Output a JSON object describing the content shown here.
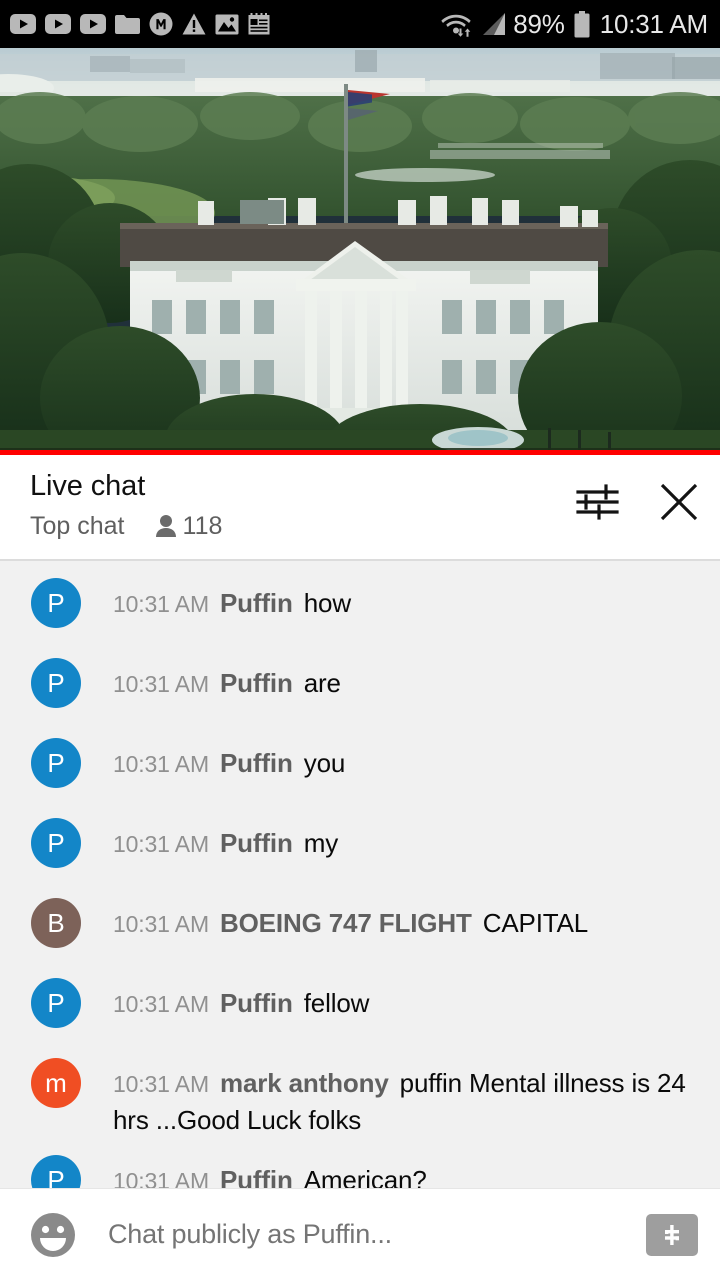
{
  "status_bar": {
    "left_icons": [
      {
        "name": "youtube-notification-icon-1",
        "glyph": "youtube"
      },
      {
        "name": "youtube-notification-icon-2",
        "glyph": "youtube"
      },
      {
        "name": "youtube-notification-icon-3",
        "glyph": "youtube"
      },
      {
        "name": "folder-icon",
        "glyph": "folder"
      },
      {
        "name": "opera-m-icon",
        "glyph": "circle-m"
      },
      {
        "name": "warning-triangle-icon",
        "glyph": "warning"
      },
      {
        "name": "image-icon",
        "glyph": "image"
      },
      {
        "name": "notepad-icon",
        "glyph": "notepad"
      }
    ],
    "wifi_icon": "wifi-data-transfer-icon",
    "signal_icon": "cellular-signal-icon",
    "battery_percent": "89%",
    "battery_icon": "battery-icon",
    "clock": "10:31 AM"
  },
  "player": {
    "name": "video-player",
    "scene_description": "White House live stream",
    "progress_percent": 100,
    "progress_color": "#ff0000"
  },
  "chat_header": {
    "title": "Live chat",
    "subtitle": "Top chat",
    "viewer_icon": "person-icon",
    "viewer_count": "118",
    "settings_icon": "tune-sliders-icon",
    "close_icon": "close-icon"
  },
  "messages": [
    {
      "initial": "P",
      "color": "#1386c8",
      "time": "10:31 AM",
      "author": "Puffin",
      "text": "how"
    },
    {
      "initial": "P",
      "color": "#1386c8",
      "time": "10:31 AM",
      "author": "Puffin",
      "text": "are"
    },
    {
      "initial": "P",
      "color": "#1386c8",
      "time": "10:31 AM",
      "author": "Puffin",
      "text": "you"
    },
    {
      "initial": "P",
      "color": "#1386c8",
      "time": "10:31 AM",
      "author": "Puffin",
      "text": "my"
    },
    {
      "initial": "B",
      "color": "#7d6259",
      "time": "10:31 AM",
      "author": "BOEING 747 FLIGHT",
      "text": "CAPITAL"
    },
    {
      "initial": "P",
      "color": "#1386c8",
      "time": "10:31 AM",
      "author": "Puffin",
      "text": "fellow"
    },
    {
      "initial": "m",
      "color": "#f04e23",
      "time": "10:31 AM",
      "author": "mark anthony",
      "text": "puffin Mental illness is 24 hrs ...Good Luck folks"
    },
    {
      "initial": "P",
      "color": "#1386c8",
      "time": "10:31 AM",
      "author": "Puffin",
      "text": "American?"
    }
  ],
  "input_bar": {
    "emoji_icon": "emoji-smiley-icon",
    "placeholder": "Chat publicly as Puffin...",
    "value": "",
    "superchat_icon": "dollar-superchat-icon"
  }
}
